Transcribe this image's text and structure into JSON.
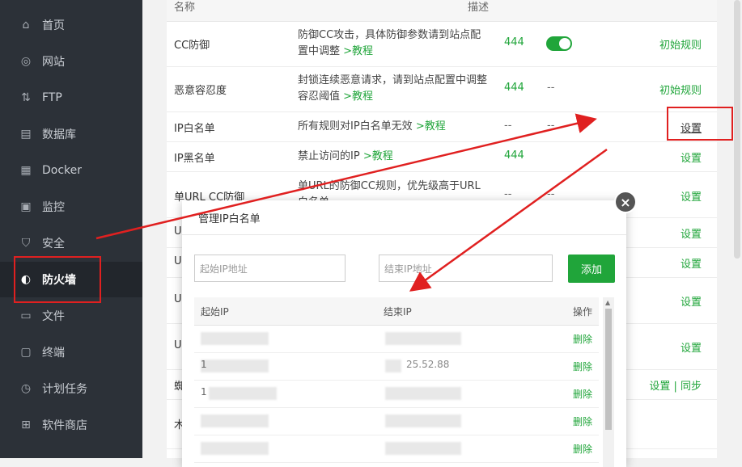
{
  "sidebar": {
    "items": [
      {
        "label": "首页",
        "icon": "home-icon",
        "glyph": "⌂"
      },
      {
        "label": "网站",
        "icon": "globe-icon",
        "glyph": "◎"
      },
      {
        "label": "FTP",
        "icon": "ftp-icon",
        "glyph": "⇅"
      },
      {
        "label": "数据库",
        "icon": "database-icon",
        "glyph": "▤"
      },
      {
        "label": "Docker",
        "icon": "docker-icon",
        "glyph": "▦"
      },
      {
        "label": "监控",
        "icon": "monitor-icon",
        "glyph": "▣"
      },
      {
        "label": "安全",
        "icon": "shield-icon",
        "glyph": "⛉"
      },
      {
        "label": "防火墙",
        "icon": "firewall-icon",
        "glyph": "◐"
      },
      {
        "label": "文件",
        "icon": "folder-icon",
        "glyph": "▭"
      },
      {
        "label": "终端",
        "icon": "terminal-icon",
        "glyph": "▢"
      },
      {
        "label": "计划任务",
        "icon": "clock-icon",
        "glyph": "◷"
      },
      {
        "label": "软件商店",
        "icon": "apps-icon",
        "glyph": "⊞"
      }
    ],
    "active_index": 7
  },
  "table": {
    "col_name": "名称",
    "col_desc": "描述",
    "rows": [
      {
        "name": "CC防御",
        "desc": "防御CC攻击，具体防御参数请到站点配置中调整",
        "link": ">教程",
        "num": "444",
        "op": "初始规则"
      },
      {
        "name": "恶意容忍度",
        "desc": "封锁连续恶意请求，请到站点配置中调整容忍阈值",
        "link": ">教程",
        "num": "444",
        "dash2": "--",
        "op": "初始规则"
      },
      {
        "name": "IP白名单",
        "desc": "所有规则对IP白名单无效",
        "link": ">教程",
        "num": "--",
        "dash2": "--",
        "op": "设置"
      },
      {
        "name": "IP黑名单",
        "desc": "禁止访问的IP",
        "link": ">教程",
        "num": "444",
        "op": "设置"
      },
      {
        "name": "单URL CC防御",
        "desc": "单URL的防御CC规则，优先级高于URL白名单",
        "num": "--",
        "dash2": "--",
        "op": "设置"
      },
      {
        "name": "U",
        "op": "设置"
      },
      {
        "name": "U",
        "op": "设置"
      },
      {
        "name": "U",
        "op": "设置"
      },
      {
        "name": "U",
        "op": "设置"
      },
      {
        "name": "蜘",
        "op": "设置 | 同步"
      },
      {
        "name": "木"
      }
    ]
  },
  "modal": {
    "title": "管理IP白名单",
    "close": "×",
    "start_placeholder": "起始IP地址",
    "end_placeholder": "结束IP地址",
    "add_label": "添加",
    "col_start": "起始IP",
    "col_end": "结束IP",
    "col_op": "操作",
    "rows": [
      {
        "start": "",
        "end": "",
        "del": "删除"
      },
      {
        "start": "1",
        "end": "25.52.88",
        "del": "删除"
      },
      {
        "start": "1",
        "end": "",
        "del": "删除"
      },
      {
        "start": "",
        "end": "",
        "del": "删除"
      },
      {
        "start": "",
        "end": "",
        "del": "删除"
      }
    ]
  },
  "colors": {
    "accent": "#20a53a",
    "sidebar_bg": "#2c3138",
    "annotation": "#e02020"
  }
}
